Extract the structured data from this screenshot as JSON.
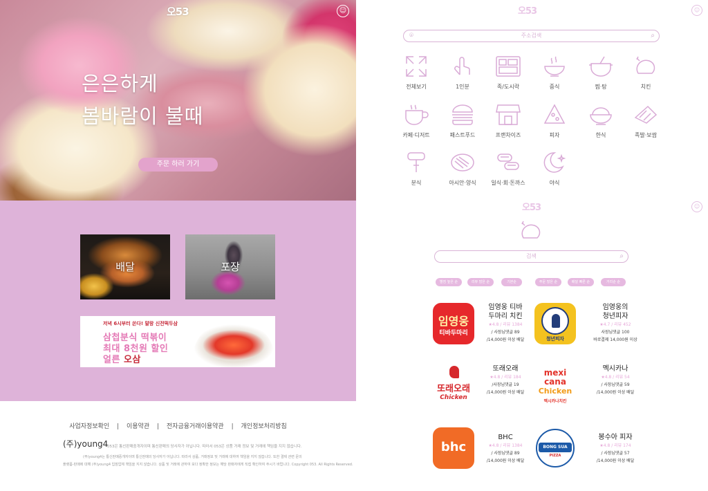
{
  "left": {
    "logo": "오53",
    "hero": {
      "line1": "은은하게",
      "line2": "봄바람이 불때",
      "order_button": "주문 하러 가기"
    },
    "tiles": [
      {
        "label": "배달"
      },
      {
        "label": "포장"
      }
    ],
    "banner": {
      "top_text": "저녁 6시부터 쏜다! 말랑 신전떡두삼",
      "line1": "삼첩분식 떡볶이",
      "line2": "최대 8천원 할인",
      "line3_prefix": "얼른",
      "line3_accent": "오삼"
    },
    "footer": {
      "links": [
        "사업자정보확인",
        "|",
        "이용약관",
        "|",
        "전자금융거래이용약관",
        "|",
        "개인정보처리방침"
      ],
      "company": "(주)young4",
      "small1": "053은 통신판매중개자이며 통신판매의 당사자가 아닙니다. 따라서 053은 상품 거래 정보 및 거래에 책임을 지지 않습니다.",
      "small2": "(주)young4는 통신판매중개자이며 통신판매의 당사자가 아닙니다. 따라서 상품, 거래정보 및 거래에 대하여 책임을 지지 않습니다. 또한 결제 관련 문의",
      "small3": "플랫폼-판매에 대해 (주)young4 입점업체 책임을 지지 않습니다. 상품 및 거래에 관하여 보다 정확한 정보는 해당 판매자에게 직접 확인하여 주시기 바랍니다. Copyright 053. All Rights Reserved."
    }
  },
  "right": {
    "logo": "오53",
    "search_placeholder": "주소검색",
    "categories": [
      {
        "label": "전체보기",
        "icon": "expand-icon"
      },
      {
        "label": "1인분",
        "icon": "hand-icon"
      },
      {
        "label": "족/도시락",
        "icon": "lunchbox-icon"
      },
      {
        "label": "중식",
        "icon": "bowl-icon"
      },
      {
        "label": "찜·탕",
        "icon": "pot-icon"
      },
      {
        "label": "치킨",
        "icon": "chicken-icon"
      },
      {
        "label": "카페·디저트",
        "icon": "coffee-icon"
      },
      {
        "label": "패스트푸드",
        "icon": "burger-icon"
      },
      {
        "label": "프랜차이즈",
        "icon": "store-icon"
      },
      {
        "label": "피자",
        "icon": "pizza-icon"
      },
      {
        "label": "한식",
        "icon": "rice-icon"
      },
      {
        "label": "족발·보쌈",
        "icon": "pork-icon"
      },
      {
        "label": "분식",
        "icon": "skewer-icon"
      },
      {
        "label": "아시안·양식",
        "icon": "steak-icon"
      },
      {
        "label": "일식·회·돈까스",
        "icon": "sushi-icon"
      },
      {
        "label": "야식",
        "icon": "moon-icon"
      }
    ],
    "section2": {
      "logo": "오53",
      "search_placeholder": "검색",
      "filters": [
        "별점 높은 순",
        "리뷰 많은 순",
        "기본순",
        "주문 많은 순",
        "배달 빠른 순",
        "거리순 순"
      ]
    },
    "stores": [
      {
        "name": "임영웅 티바\n두마리 치킨",
        "rating": "★4.8 / 리뷰 1384",
        "comments": "/ 사장님댓글 89",
        "min": "/14,000원 이상 배달",
        "logo_text1": "임영웅",
        "logo_text2": "티바두마리"
      },
      {
        "name": "임영웅의\n청년피자",
        "rating": "★4.7 / 리뷰 452",
        "comments": "사장님댓글 100",
        "min": "바로결제 14,000원 이상",
        "logo_text1": "청년피자"
      },
      {
        "name": "또래오래",
        "rating": "★4.8 / 리뷰 184",
        "comments": "/사장님댓글 19",
        "min": "/14,000원 이상 배달",
        "logo_text1": "또래오래",
        "logo_text2": "Chicken"
      },
      {
        "name": "멕시카나",
        "rating": "★4.8 / 리뷰 54",
        "comments": "/ 사장님댓글 59",
        "min": "/14,000원 이상 배달",
        "logo_text1": "mexi cana",
        "logo_text2": "Chicken",
        "logo_text3": "멕시카나치킨"
      },
      {
        "name": "BHC",
        "rating": "★4.8 / 리뷰 1384",
        "comments": "/ 사장님댓글 89",
        "min": "/14,000원 이상 배달",
        "logo_text1": "bhc"
      },
      {
        "name": "봉수아 피자",
        "rating": "★4.8 / 리뷰 174",
        "comments": "/ 사장님댓글 57",
        "min": "/14,000원 이상 배달",
        "logo_text1": "BONG SUA",
        "logo_text2": "PIZZA"
      }
    ]
  }
}
